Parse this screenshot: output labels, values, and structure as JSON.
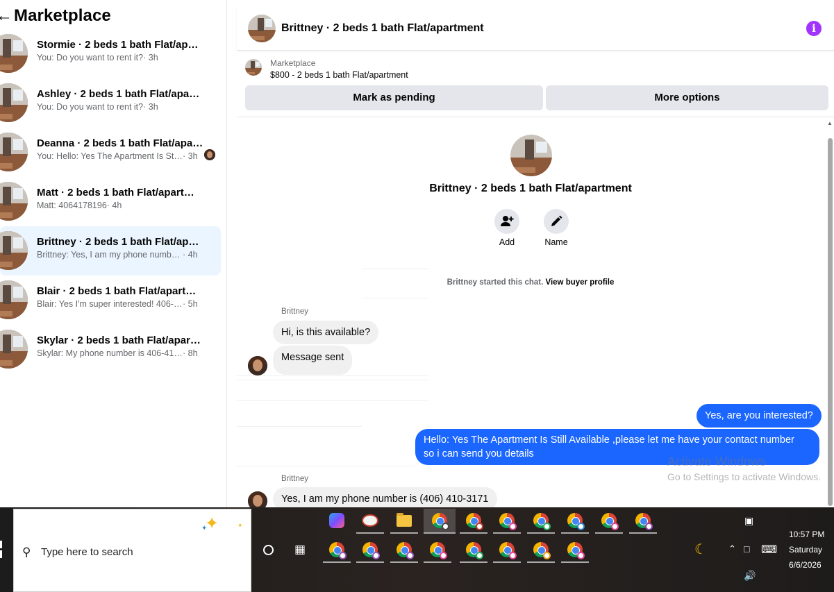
{
  "sidebar": {
    "title": "Marketplace",
    "back_icon": "arrow-left-icon",
    "conversations": [
      {
        "name": "Stormie · 2 beds 1 bath Flat/apart...",
        "snippet": "You: Do you want to rent it?",
        "time": "· 3h"
      },
      {
        "name": "Ashley · 2 beds 1 bath Flat/apartm...",
        "snippet": "You: Do you want to rent it?",
        "time": "· 3h"
      },
      {
        "name": "Deanna · 2 beds 1 bath Flat/apar...",
        "snippet": "You: Hello: Yes The Apartment Is Sti...",
        "time": "· 3h"
      },
      {
        "name": "Matt · 2 beds 1 bath Flat/apartment",
        "snippet": "Matt: 4064178196",
        "time": "· 4h"
      },
      {
        "name": "Brittney · 2 beds 1 bath Flat/apart...",
        "snippet": "Brittney: Yes, I am my phone number i...",
        "time": "· 4h"
      },
      {
        "name": "Blair · 2 beds 1 bath Flat/apartment",
        "snippet": "Blair: Yes I'm super interested! 406-66...",
        "time": "· 5h"
      },
      {
        "name": "Skylar · 2 beds 1 bath Flat/apartme...",
        "snippet": "Skylar: My phone number is 406-417-...",
        "time": "· 8h"
      }
    ]
  },
  "chat": {
    "title": "Brittney · 2 beds 1 bath Flat/apartment",
    "info_icon": "info-icon",
    "info_glyph": "i",
    "listing": {
      "source": "Marketplace",
      "price_title": "$800 - 2 beds 1 bath Flat/apartment",
      "mark_pending": "Mark as pending",
      "more_options": "More options"
    },
    "intro": {
      "title": "Brittney · 2 beds 1 bath Flat/apartment",
      "add_label": "Add",
      "name_label": "Name",
      "started_text": "Brittney started this chat.",
      "view_profile": "View buyer profile"
    },
    "messages": {
      "sender1": "Brittney",
      "in1": "Hi, is this available?",
      "in2": "Message sent",
      "out1": "Yes, are you interested?",
      "out2_line1": "Hello: Yes The Apartment Is Still Available ,please let me have your contact number",
      "out2_line2": "so i can send you details",
      "sender2": "Brittney",
      "in3": "Yes, I am my phone number is (406) 410-3171"
    },
    "colors": {
      "outgoing": "#1a66ff",
      "incoming": "#f0f0f0",
      "accent": "#a033ff"
    }
  },
  "watermark": {
    "line1": "Activate Windows",
    "line2": "Go to Settings to activate Windows."
  },
  "taskbar": {
    "search_placeholder": "Type here to search",
    "clock_time": "10:57 PM",
    "clock_day": "Saturday",
    "clock_date": "6/6/2026"
  }
}
